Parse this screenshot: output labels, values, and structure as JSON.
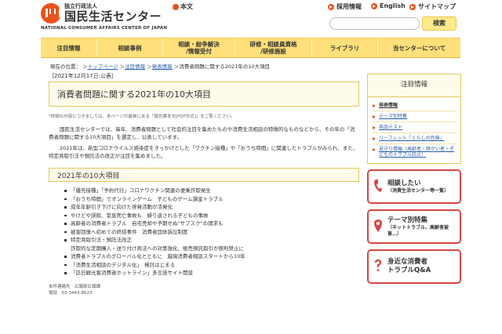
{
  "header": {
    "logo_sub": "独立行政法人",
    "logo_main": "国民生活センター",
    "logo_en": "NATIONAL CONSUMER AFFAIRS CENTER OF JAPAN",
    "fontsize_label": "本文",
    "links": [
      "採用情報",
      "English",
      "サイトマップ"
    ],
    "search_button": "検索",
    "accent_color": "#e8531c"
  },
  "nav": {
    "items": [
      [
        "注目情報"
      ],
      [
        "相談事例"
      ],
      [
        "相談・紛争解決",
        "/情報受付"
      ],
      [
        "研修・相談員資格",
        "/研修施設"
      ],
      [
        "ライブラリ"
      ],
      [
        "当センターについて"
      ]
    ],
    "bg_color": "#ffe07a"
  },
  "breadcrumb": {
    "current_label": "現在の位置：",
    "links": [
      "トップページ",
      "注目情報",
      "発表情報"
    ],
    "current": "消費者問題に関する2021年の10大項目"
  },
  "main": {
    "date": "［2021年12月17日:公表］",
    "title": "消費者問題に関する2021年の10大項目",
    "note": "*詳細な内容につきましては、本ページの最後にある「報告書本文[PDF形式]」をご覧ください。",
    "paragraphs": [
      "国民生活センターでは、毎年、消費者問題として社会的注目を集めたものや消費生活相談の特徴的なものなどから、その年の「消費者問題に関する10大項目」を選定し、公表しています。",
      "2021年は、新型コロナウイルス感染症をきっかけとした「ワクチン接種」や「おうち時間」に関連したトラブルがみられ、また、特定商取引法や預託法の改正が注目を集めました。"
    ],
    "section_title": "2021年の10大項目",
    "items": [
      {
        "text": "「優先接種」「予約代行」コロナワクチン関連の便乗詐欺発生",
        "sub": false
      },
      {
        "text": "「おうち時間」でオンラインゲーム　子どものゲーム課金トラブル",
        "sub": false
      },
      {
        "text": "成年年齢引き下げに向けた啓発活動が活発化",
        "sub": false
      },
      {
        "text": "やけどや誤飲、窒息死亡事故も　繰り返される子どもの事故",
        "sub": false
      },
      {
        "text": "高齢者の消費者トラブル　自宅売却や予期せぬ\"サブスク\"の請求も",
        "sub": false
      },
      {
        "text": "被害回復へ初めての終結事件　消費者団体訴訟制度",
        "sub": false
      },
      {
        "text": "特定商取引法・預託法改正",
        "sub": false
      },
      {
        "text": "詐欺的な定期購入・送り付け商法への対策強化、販売預託取引が原則禁止に",
        "sub": true
      },
      {
        "text": "消費者トラブルのグローバル化とともに　越境消費者相談スタートから10年",
        "sub": false
      },
      {
        "text": "「消費生活相談のデジタル化」　検討はじまる",
        "sub": false
      },
      {
        "text": "「訪日観光客消費者ホットライン」多言語サイト開設",
        "sub": false
      }
    ],
    "contact_lines": [
      "本件連絡先　広報部広報課",
      "電話　03-3443-8623"
    ]
  },
  "sidebar": {
    "heading": "注目情報",
    "items": [
      {
        "label": "発表情報",
        "active": true
      },
      {
        "label": "テーマ別特集",
        "active": false
      },
      {
        "label": "商品テスト",
        "active": false
      },
      {
        "label": "リーフレット「くらしの危険」",
        "active": false
      },
      {
        "label": "見守り情報（高齢者・障がい者・子どものトラブル防止）",
        "active": false
      }
    ],
    "banners": [
      {
        "line1": "相談したい",
        "line2": "（消費生活センター等一覧）",
        "icon": "phone-icon"
      },
      {
        "line1": "テーマ別特集",
        "line2": "（ネットトラブル、高齢者被害…）",
        "icon": "pin-icon"
      },
      {
        "line1": "身近な消費者",
        "line2": "トラブルQ&A",
        "icon": "question-icon"
      }
    ],
    "banner_color": "#d94545"
  }
}
